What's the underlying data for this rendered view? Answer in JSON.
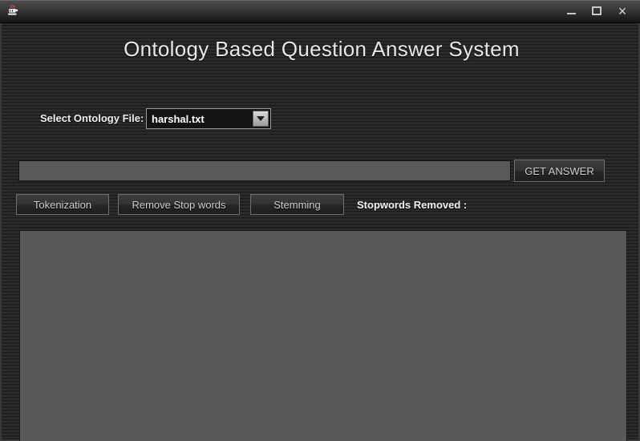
{
  "window": {
    "app_icon": "java-coffee-cup-icon",
    "controls": {
      "minimize": "minimize-icon",
      "maximize": "maximize-icon",
      "close": "×"
    }
  },
  "heading": {
    "title": "Ontology Based Question Answer System"
  },
  "ontology": {
    "label": "Select Ontology File:",
    "selected": "harshal.txt",
    "options": [
      "harshal.txt"
    ],
    "arrow_icon": "chevron-down-icon"
  },
  "query": {
    "value": "",
    "placeholder": "",
    "get_answer_label": "GET ANSWER"
  },
  "actions": {
    "tokenization_label": "Tokenization",
    "remove_stopwords_label": "Remove Stop words",
    "stemming_label": "Stemming",
    "stopwords_removed_label": "Stopwords Removed :"
  },
  "output": {
    "value": "",
    "placeholder": ""
  },
  "colors": {
    "window_background": "#262626",
    "title_bar_top": "#4e4e4e",
    "title_bar_bottom": "#151515",
    "text_field_fill": "#595959",
    "heading_text": "#e8e8e8",
    "button_border": "#6e6e6e",
    "combo_fill": "#141414"
  }
}
